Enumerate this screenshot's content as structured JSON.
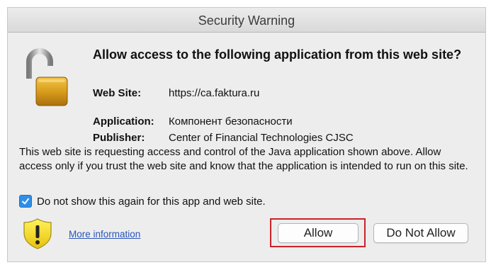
{
  "window": {
    "title": "Security Warning"
  },
  "heading": "Allow access to the following application from this web site?",
  "details": [
    {
      "label": "Web Site:",
      "value": "https://ca.faktura.ru"
    },
    {
      "label": "Application:",
      "value": "Компонент безопасности"
    },
    {
      "label": "Publisher:",
      "value": "Center of Financial Technologies CJSC"
    }
  ],
  "description": "This web site is requesting access and control of the Java application shown above. Allow access only if you trust the web site and know that the application is intended to run on this site.",
  "checkbox": {
    "label": "Do not show this again for this app and web site.",
    "checked": true
  },
  "footer": {
    "more_info_link": "More information",
    "allow_label": "Allow",
    "deny_label": "Do Not Allow"
  },
  "icons": {
    "lock": "unlocked-padlock-icon",
    "warning": "warning-shield-icon",
    "checkbox": "checkmark-icon"
  },
  "colors": {
    "highlight_border": "#c9232b",
    "checkbox_accent": "#2f8ee8",
    "link": "#2a55b8",
    "lock_gold": "#d9a421"
  }
}
